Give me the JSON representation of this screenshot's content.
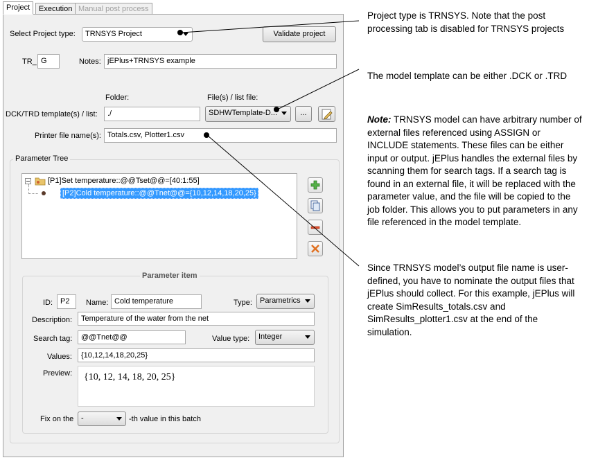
{
  "tabs": [
    {
      "label": "Project"
    },
    {
      "label": "Execution"
    },
    {
      "label": "Manual post process"
    }
  ],
  "project": {
    "type_label": "Select Project type:",
    "type_value": "TRNSYS Project",
    "validate_button": "Validate project",
    "prefix_label": "TR_",
    "prefix_value": "G",
    "notes_label": "Notes:",
    "notes_value": "jEPlus+TRNSYS example",
    "folder_header": "Folder:",
    "files_header": "File(s) / list file:",
    "template_label": "DCK/TRD template(s) / list:",
    "folder_value": "./",
    "file_value": "SDHWTemplate-D...",
    "browse_button": "...",
    "printer_label": "Printer file name(s):",
    "printer_value": "Totals.csv, Plotter1.csv"
  },
  "parameter_tree": {
    "title": "Parameter Tree",
    "nodes": [
      {
        "label": "[P1]Set temperature::@@Tset@@=[40:1:55]"
      },
      {
        "label": "[P2]Cold temperature::@@Tnet@@={10,12,14,18,20,25}"
      }
    ]
  },
  "parameter_item": {
    "title": "Parameter item",
    "id_label": "ID:",
    "id_value": "P2",
    "name_label": "Name:",
    "name_value": "Cold temperature",
    "type_label": "Type:",
    "type_value": "Parametrics",
    "description_label": "Description:",
    "description_value": "Temperature of the water from the net",
    "search_tag_label": "Search tag:",
    "search_tag_value": "@@Tnet@@",
    "value_type_label": "Value type:",
    "value_type_value": "Integer",
    "values_label": "Values:",
    "values_value": "{10,12,14,18,20,25}",
    "preview_label": "Preview:",
    "preview_value": "{10, 12, 14, 18, 20, 25}",
    "fix_label": "Fix on the",
    "fix_value": "-",
    "fix_suffix": "-th value in this batch"
  },
  "annotations": {
    "note1": "Project type is TRNSYS. Note that the post processing tab is disabled for TRNSYS projects",
    "note2": "The model template can be either .DCK or .TRD",
    "note3_bold": "Note:",
    "note3_rest": " TRNSYS model can have arbitrary number of external files referenced using ASSIGN or INCLUDE statements. These files can be either input or output. jEPlus handles the external files by scanning them for search tags. If a search tag is found in an external file, it will be replaced with the parameter value, and the file will be copied to the job folder. This allows you to put parameters in any file referenced in the model template.",
    "note4": "Since TRNSYS model’s output file name is user-defined, you have to nominate the output files that jEPlus should collect. For this example, jEPlus will create SimResults_totals.csv and SimResults_plotter1.csv at the end of the simulation."
  },
  "colors": {
    "selection": "#3399ff",
    "panel_bg": "#f0f0f0"
  }
}
